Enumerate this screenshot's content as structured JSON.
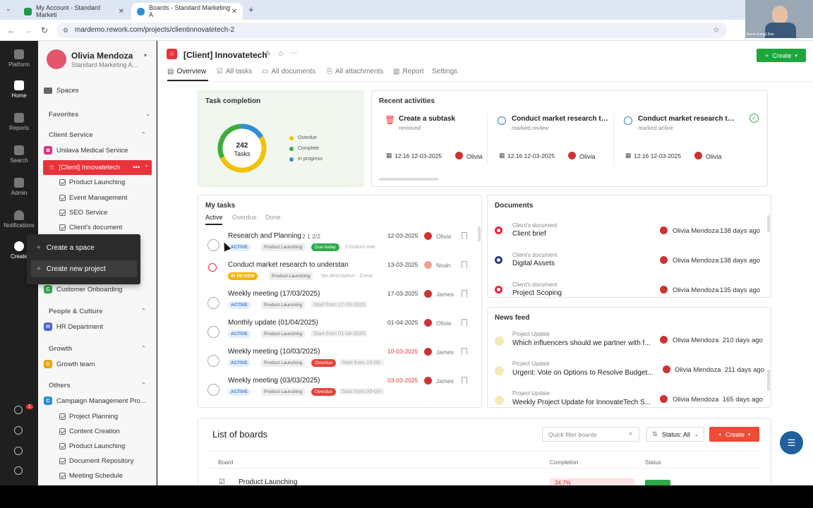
{
  "browser": {
    "tabs": [
      {
        "title": "My Account - Standard Marketi",
        "active": false,
        "color": "#1a9c4a"
      },
      {
        "title": "Boards - Standard Marketing A",
        "active": true,
        "color": "#2a8fd6"
      }
    ],
    "url": "mardemo.rework.com/projects/clientinnovatetech-2"
  },
  "rail": {
    "items": [
      "Platform",
      "Home",
      "Reports",
      "Search",
      "Admin",
      "Notifications",
      "Create"
    ],
    "badge": "1"
  },
  "sidebar": {
    "user_name": "Olivia Mendoza",
    "workspace": "Standard Marketing A...",
    "spaces": "Spaces",
    "favorites": "Favorites",
    "client_service": "Client Service",
    "unilava": "Unilava Medical Service",
    "active_project": "[Client] Innovatetech",
    "subitems": [
      "Product Launching",
      "Event Management",
      "SEO Service",
      "Client's document"
    ],
    "customer_onboarding": "Customer Onboarding",
    "people_culture": "People & Culture",
    "hr": "HR Department",
    "growth": "Growth",
    "growth_team": "Growth team",
    "others": "Others",
    "campaign": "Campaign Management Pro...",
    "others_sub": [
      "Project Planning",
      "Content Creation",
      "Product Launching",
      "Document Repository",
      "Meeting Schedule"
    ]
  },
  "popup": {
    "create_space": "Create a space",
    "create_project": "Create new project"
  },
  "header": {
    "title": "[Client] Innovatetech",
    "create": "Create",
    "tabs": [
      "Overview",
      "All tasks",
      "All documents",
      "All attachments",
      "Report",
      "Settings"
    ]
  },
  "task_completion": {
    "title": "Task completion",
    "count": "242",
    "unit": "Tasks",
    "legend": [
      "Overdue",
      "Complete",
      "In progress"
    ],
    "colors": {
      "overdue": "#f2c200",
      "complete": "#3cae3c",
      "in_progress": "#2f8fd6"
    }
  },
  "recent": {
    "title": "Recent activities",
    "items": [
      {
        "title": "Create a subtask",
        "status": "removed",
        "time": "12:16 12-03-2025",
        "who": "Olivia"
      },
      {
        "title": "Conduct market research to...",
        "status": "marked review",
        "time": "12:16 12-03-2025",
        "who": "Olivia"
      },
      {
        "title": "Conduct market research to...",
        "status": "marked active",
        "time": "12:16 12-03-2025",
        "who": "Olivia"
      }
    ]
  },
  "my_tasks": {
    "title": "My tasks",
    "tabs": [
      "Active",
      "Overdue",
      "Done"
    ],
    "rows": [
      {
        "title": "Research and Planning",
        "meta": "2   1   2/2",
        "badge": "ACTIVE",
        "project": "Product Launching",
        "pill": "Due today",
        "extra": "Conduct mar",
        "date": "12-03-2025",
        "who": "Olivia"
      },
      {
        "title": "Conduct market research to understan",
        "badge": "IN REVIEW",
        "project": "Product Launching",
        "extra": "No description · Creat",
        "date": "13-03-2025",
        "who": "Noah"
      },
      {
        "title": "Weekly meeting (17/03/2025)",
        "badge": "ACTIVE",
        "project": "Product Launching",
        "extra": "Start from 17-03-2025",
        "date": "17-03-2025",
        "who": "James"
      },
      {
        "title": "Monthly update (01/04/2025)",
        "badge": "ACTIVE",
        "project": "Product Launching",
        "extra": "Start from 01-04-2025",
        "date": "01-04-2025",
        "who": "Olivia"
      },
      {
        "title": "Weekly meeting (10/03/2025)",
        "badge": "ACTIVE",
        "project": "Product Launching",
        "pill": "Overdue",
        "extra": "Start from 10-03-",
        "date": "10-03-2025",
        "who": "James"
      },
      {
        "title": "Weekly meeting (03/03/2025)",
        "badge": "ACTIVE",
        "project": "Product Launching",
        "pill": "Overdue",
        "extra": "Start from 03-03-",
        "date": "03-03-2025",
        "who": "James"
      }
    ]
  },
  "documents": {
    "title": "Documents",
    "rows": [
      {
        "kind": "Client's document",
        "name": "Client brief",
        "user": "Olivia Mendoza",
        "time": "138 days ago"
      },
      {
        "kind": "Client's document",
        "name": "Digital Assets",
        "user": "Olivia Mendoza",
        "time": "138 days ago"
      },
      {
        "kind": "Client's document",
        "name": "Project Scoping",
        "user": "Olivia Mendoza",
        "time": "135 days ago"
      }
    ]
  },
  "news": {
    "title": "News feed",
    "rows": [
      {
        "kind": "Project Update",
        "name": "Which influencers should we partner with f...",
        "user": "Olivia Mendoza",
        "time": "210 days ago"
      },
      {
        "kind": "Project Update",
        "name": "Urgent: Vote on Options to Resolve Budget...",
        "user": "Olivia Mendoza",
        "time": "211 days ago"
      },
      {
        "kind": "Project Update",
        "name": "Weekly Project Update for InnovateTech S...",
        "user": "Olivia Mendoza",
        "time": "165 days ago"
      }
    ]
  },
  "boards": {
    "title": "List of boards",
    "search_placeholder": "Quick filter boards",
    "status_filter": "Status: All",
    "create": "Create",
    "col_board": "Board",
    "col_completion": "Completion",
    "col_status": "Status",
    "first_board": "Product Launching",
    "first_completion": "34.7%"
  },
  "webcam_caption": "Kevin (Leng) Kee"
}
